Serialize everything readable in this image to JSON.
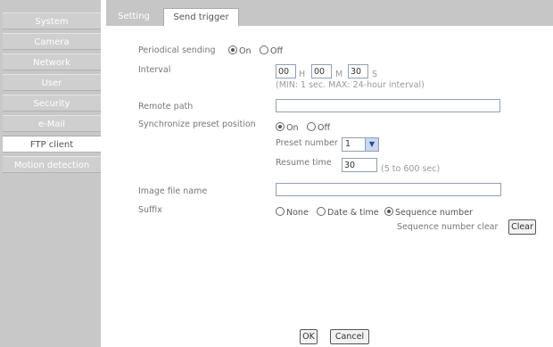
{
  "sidebar": {
    "items": [
      {
        "label": "System"
      },
      {
        "label": "Camera"
      },
      {
        "label": "Network"
      },
      {
        "label": "User"
      },
      {
        "label": "Security"
      },
      {
        "label": "e-Mail"
      },
      {
        "label": "FTP client"
      },
      {
        "label": "Motion detection"
      }
    ],
    "active": "FTP client"
  },
  "tabs": [
    {
      "label": "Setting"
    },
    {
      "label": "Send trigger"
    }
  ],
  "form": {
    "periodical_sending": {
      "label": "Periodical sending",
      "on": "On",
      "off": "Off",
      "selected": "On"
    },
    "interval": {
      "label": "Interval",
      "hours": "00",
      "h": "H",
      "minutes": "00",
      "m": "M",
      "seconds": "30",
      "s": "S",
      "hint": "(MIN: 1 sec. MAX: 24-hour interval)"
    },
    "remote_path": {
      "label": "Remote path",
      "value": ""
    },
    "sync_preset": {
      "label": "Synchronize preset position",
      "on": "On",
      "off": "Off",
      "selected": "On"
    },
    "preset_number": {
      "label": "Preset number",
      "value": "1"
    },
    "resume_time": {
      "label": "Resume time",
      "value": "30",
      "hint": "(5 to 600 sec)"
    },
    "image_file_name": {
      "label": "Image file name",
      "value": ""
    },
    "suffix": {
      "label": "Suffix",
      "none": "None",
      "date_time": "Date & time",
      "sequence": "Sequence number",
      "selected": "Sequence number"
    },
    "sequence_clear": {
      "label": "Sequence number clear",
      "button": "Clear"
    }
  },
  "buttons": {
    "ok": "OK",
    "cancel": "Cancel"
  }
}
